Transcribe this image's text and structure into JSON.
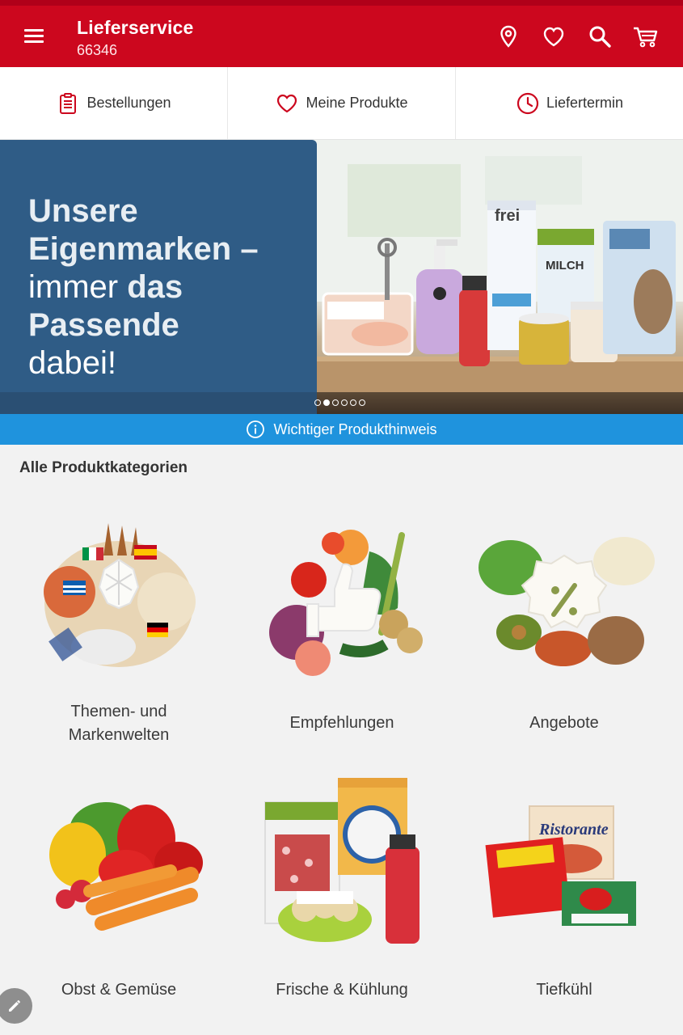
{
  "app": {
    "title": "Lieferservice",
    "zip": "66346",
    "brand_color": "#cc071e"
  },
  "appbar_icons": [
    "menu-icon",
    "location-pin-icon",
    "heart-icon",
    "search-icon",
    "cart-icon"
  ],
  "quicktabs": [
    {
      "label": "Bestellungen",
      "icon": "clipboard-icon"
    },
    {
      "label": "Meine Produkte",
      "icon": "heart-outline-icon"
    },
    {
      "label": "Liefertermin",
      "icon": "clock-icon"
    }
  ],
  "hero": {
    "line1": "Unsere",
    "line2": "Eigenmarken –",
    "line3_regular": "immer ",
    "line3_bold": "das Passende",
    "line4": "dabei!",
    "slide_count": 6,
    "active_slide": 1,
    "panel_color": "#2f5c86"
  },
  "notice": {
    "label": "Wichtiger Produkthinweis",
    "icon": "info-icon",
    "color": "#1f93dd"
  },
  "categories_section": {
    "title": "Alle Produktkategorien",
    "items": [
      {
        "label_line1": "Themen- und",
        "label_line2": "Markenwelten",
        "icon": "world-cuisine-icon"
      },
      {
        "label_line1": "Empfehlungen",
        "label_line2": "",
        "icon": "thumbs-up-icon"
      },
      {
        "label_line1": "Angebote",
        "label_line2": "",
        "icon": "percent-badge-icon"
      },
      {
        "label_line1": "Obst & Gemüse",
        "label_line2": "",
        "icon": "vegetables-icon"
      },
      {
        "label_line1": "Frische & Kühlung",
        "label_line2": "",
        "icon": "fresh-products-icon"
      },
      {
        "label_line1": "Tiefkühl",
        "label_line2": "",
        "icon": "frozen-food-icon"
      }
    ]
  },
  "fab": {
    "icon": "pencil-icon"
  }
}
